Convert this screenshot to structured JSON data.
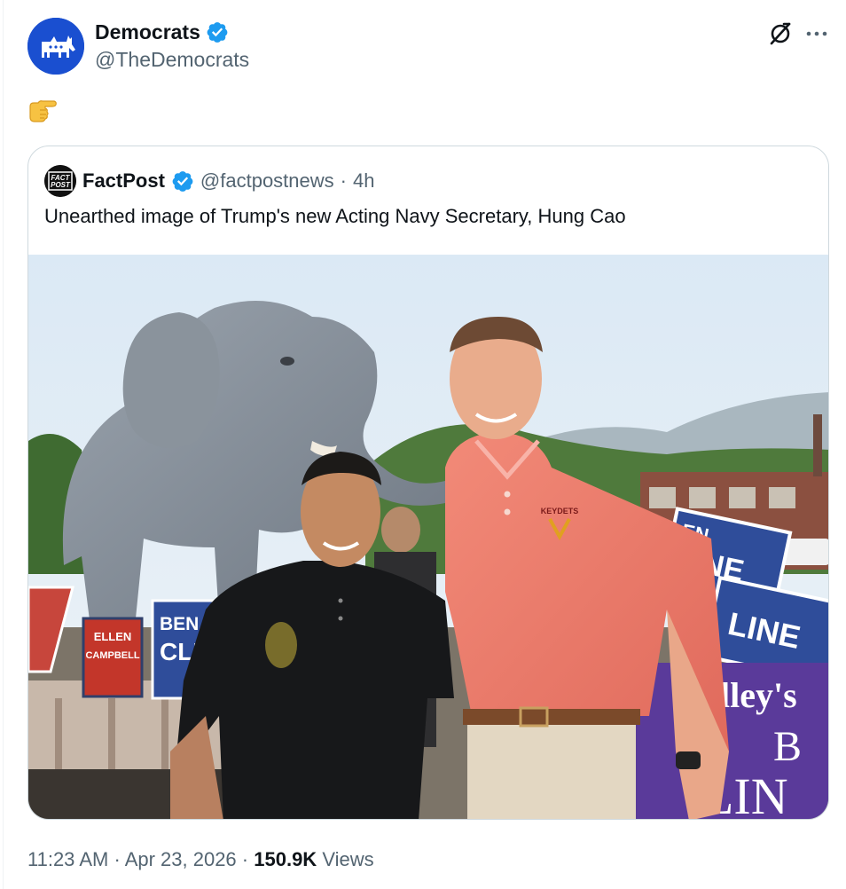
{
  "author": {
    "display_name": "Democrats",
    "handle": "@TheDemocrats",
    "avatar_icon": "donkey-logo-icon",
    "avatar_color": "#1a4fd0",
    "verified": true
  },
  "tweet": {
    "body_emoji": "pointing-right-hand-emoji"
  },
  "quoted_tweet": {
    "display_name": "FactPost",
    "avatar_lines": [
      "FACT",
      "POST"
    ],
    "handle": "@factpostnews",
    "separator": "·",
    "time": "4h",
    "verified": true,
    "text": "Unearthed image of Trump's new Acting Navy Secretary, Hung Cao",
    "image_signs": {
      "sign_left_1": [
        "ELLEN",
        "CAMPBELL"
      ],
      "sign_left_2": [
        "BEN",
        "CLIN"
      ],
      "sign_right_1": [
        "EN",
        "LINE"
      ],
      "sign_right_2": [
        "LINE"
      ],
      "banner": [
        "alley's",
        "B",
        "LIN"
      ],
      "shirt_logo": "KEYDETS"
    }
  },
  "footer": {
    "time": "11:23 AM",
    "separator_1": "·",
    "date": "Apr 23, 2026",
    "separator_2": "·",
    "views_count": "150.9K",
    "views_label": "Views"
  },
  "colors": {
    "verified_blue": "#1d9bf0",
    "text_primary": "#0f1419",
    "text_secondary": "#536471",
    "border": "#cfd9de"
  }
}
